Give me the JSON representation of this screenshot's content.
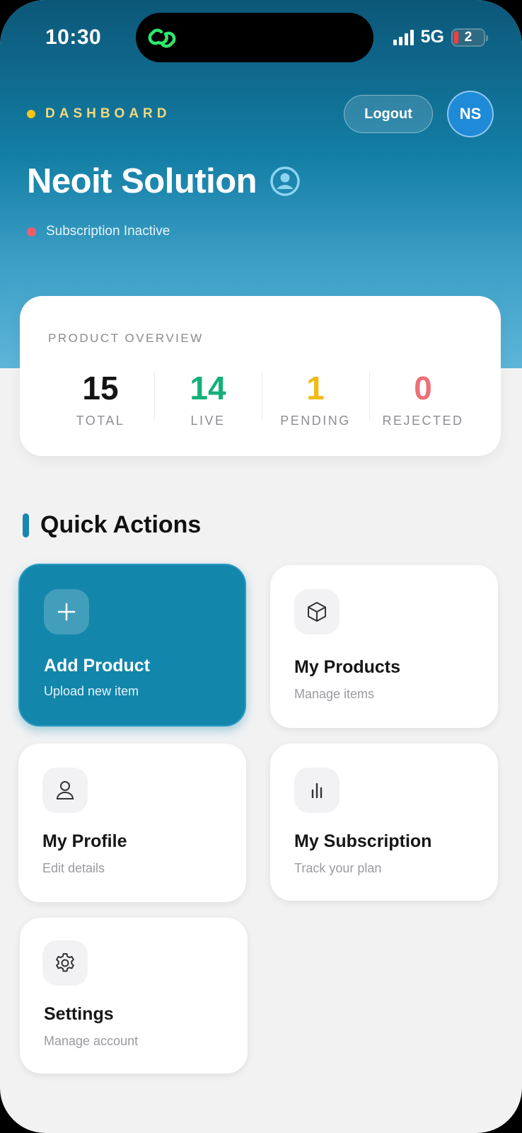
{
  "status_bar": {
    "time": "10:30",
    "network": "5G",
    "battery_level": "2"
  },
  "header": {
    "section_label": "DASHBOARD",
    "logout_label": "Logout",
    "avatar_initials": "NS",
    "company_name": "Neoit Solution",
    "subscription_status": "Subscription Inactive"
  },
  "overview": {
    "title": "PRODUCT OVERVIEW",
    "stats": [
      {
        "value": "15",
        "label": "TOTAL",
        "color": "#141414"
      },
      {
        "value": "14",
        "label": "LIVE",
        "color": "#15b07a"
      },
      {
        "value": "1",
        "label": "PENDING",
        "color": "#f1bb17"
      },
      {
        "value": "0",
        "label": "REJECTED",
        "color": "#ef6f76"
      }
    ]
  },
  "quick_actions": {
    "title": "Quick Actions",
    "items": [
      {
        "title": "Add Product",
        "subtitle": "Upload new item",
        "icon": "plus-icon"
      },
      {
        "title": "My Products",
        "subtitle": "Manage items",
        "icon": "box-icon"
      },
      {
        "title": "My Profile",
        "subtitle": "Edit details",
        "icon": "user-icon"
      },
      {
        "title": "My Subscription",
        "subtitle": "Track your plan",
        "icon": "bar-chart-icon"
      },
      {
        "title": "Settings",
        "subtitle": "Manage account",
        "icon": "gear-icon"
      }
    ]
  },
  "colors": {
    "accent": "#1386ab",
    "highlight": "#f5c518",
    "inactive_dot": "#ef5b6d"
  }
}
